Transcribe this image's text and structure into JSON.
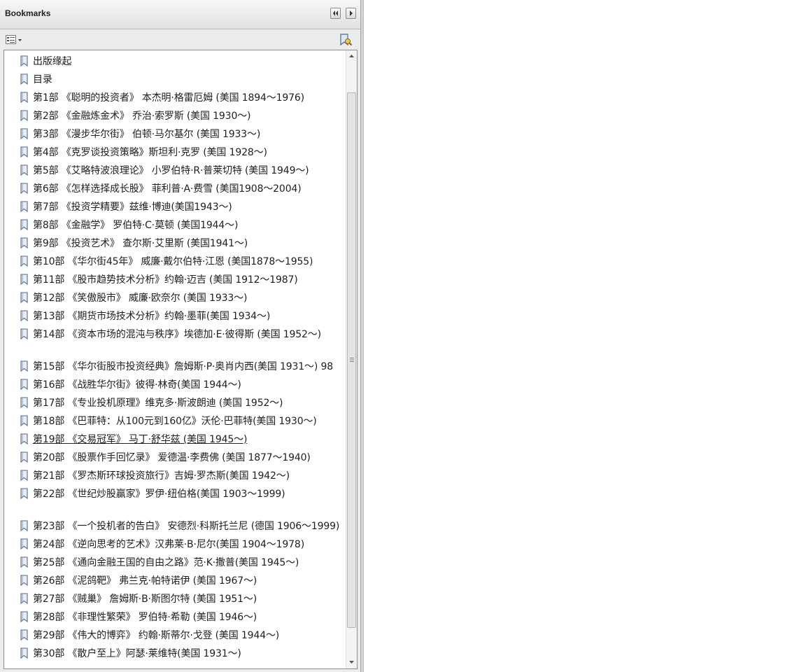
{
  "panel": {
    "title": "Bookmarks",
    "collapse_icon": "double-chevron-left-icon",
    "expand_icon": "chevron-right-icon",
    "options_icon": "list-options-icon",
    "bookmark_tool_icon": "bookmark-search-icon"
  },
  "bookmarks": [
    {
      "label": "出版缘起"
    },
    {
      "label": "目录"
    },
    {
      "label": "第1部 《聪明的投资者》 本杰明·格雷厄姆 (美国 1894～1976)"
    },
    {
      "label": "第2部 《金融炼金术》 乔治·索罗斯 (美国 1930～)"
    },
    {
      "label": "第3部 《漫步华尔街》 伯顿·马尔基尔 (美国 1933～)"
    },
    {
      "label": "第4部 《克罗谈投资策略》斯坦利·克罗 (美国 1928～)"
    },
    {
      "label": "第5部 《艾略特波浪理论》 小罗伯特·R·普莱切特 (美国 1949～)"
    },
    {
      "label": "第6部 《怎样选择成长股》 菲利普·A·费雪 (美国1908～2004)"
    },
    {
      "label": "第7部 《投资学精要》兹维·博迪(美国1943～)"
    },
    {
      "label": "第8部 《金融学》 罗伯特·C·莫顿 (美国1944～)"
    },
    {
      "label": "第9部 《投资艺术》 查尔斯·艾里斯 (美国1941～)"
    },
    {
      "label": "第10部 《华尔街45年》 威廉·戴尔伯特·江恩 (美国1878～1955)"
    },
    {
      "label": "第11部 《股市趋势技术分析》约翰·迈吉 (美国 1912～1987)"
    },
    {
      "label": "第12部 《笑傲股市》 威廉·欧奈尔 (美国 1933～)"
    },
    {
      "label": "第13部 《期货市场技术分析》约翰·墨菲(美国 1934～)"
    },
    {
      "label": "第14部 《资本市场的混沌与秩序》埃德加·E·彼得斯 (美国 1952～)"
    },
    {
      "label": "第15部 《华尔街股市投资经典》詹姆斯·P·奥肖内西(美国 1931～) 98"
    },
    {
      "label": "第16部 《战胜华尔街》彼得·林奇(美国 1944～)"
    },
    {
      "label": "第17部 《专业投机原理》维克多·斯波朗迪 (美国 1952～)"
    },
    {
      "label": "第18部 《巴菲特：从100元到160亿》沃伦·巴菲特(美国 1930～)"
    },
    {
      "label": "第19部 《交易冠军》 马丁·舒华兹 (美国 1945～)"
    },
    {
      "label": "第20部 《股票作手回忆录》 爱德温·李费佛 (美国 1877～1940)"
    },
    {
      "label": "第21部 《罗杰斯环球投资旅行》吉姆·罗杰斯(美国 1942～)"
    },
    {
      "label": "第22部 《世纪炒股赢家》罗伊·纽伯格(美国 1903～1999)"
    },
    {
      "label": "第23部 《一个投机者的告白》 安德烈·科斯托兰尼 (德国 1906～1999)"
    },
    {
      "label": "第24部 《逆向思考的艺术》汉弗莱·B·尼尔(美国 1904～1978)"
    },
    {
      "label": "第25部 《通向金融王国的自由之路》范·K·撒普(美国 1945～)"
    },
    {
      "label": "第26部 《泥鸽靶》 弗兰克·帕特诺伊 (美国 1967～)"
    },
    {
      "label": "第27部 《贼巢》 詹姆斯·B·斯图尔特 (美国 1951～)"
    },
    {
      "label": "第28部 《非理性繁荣》 罗伯特·希勒 (美国 1946～)"
    },
    {
      "label": "第29部 《伟大的博弈》 约翰·斯蒂尔·戈登 (美国 1944～)"
    },
    {
      "label": "第30部 《散户至上》阿瑟·莱维特(美国 1931～)"
    }
  ]
}
